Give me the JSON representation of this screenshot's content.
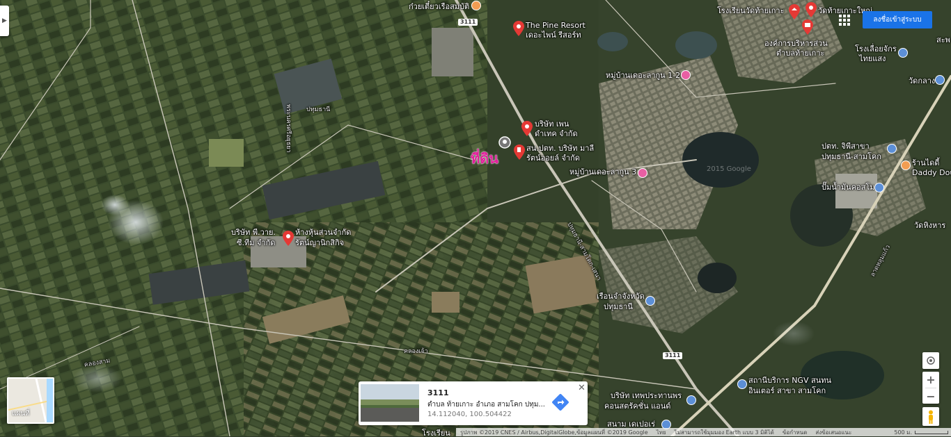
{
  "map": {
    "labels": [
      {
        "id": "pine-resort-en",
        "text": "The Pine Resort"
      },
      {
        "id": "pine-resort-th",
        "text": "เดอะไพน์ รีสอร์ท"
      },
      {
        "id": "noodle-shop",
        "text": "ก๋วยเตี๋ยวเรือสมบัติ"
      },
      {
        "id": "school",
        "text": "โรงเรียนวัดท้ายเกาะ"
      },
      {
        "id": "temple",
        "text": "วัดท้ายเกาะใหญ่"
      },
      {
        "id": "sao-1",
        "text": "องค์การบริหารส่วน"
      },
      {
        "id": "sao-2",
        "text": "ตำบลท้ายเกาะ"
      },
      {
        "id": "sawmill-1",
        "text": "โรงเลื่อยจักร"
      },
      {
        "id": "sawmill-2",
        "text": "ไทยแสง"
      },
      {
        "id": "wat-klang",
        "text": "วัดกลาง"
      },
      {
        "id": "sapha",
        "text": "สะพ"
      },
      {
        "id": "village-1-2",
        "text": "หมู่บ้านเดอะลากูน 1-2"
      },
      {
        "id": "village-3",
        "text": "หมู่บ้านเดอะลากูน 3"
      },
      {
        "id": "penn-1",
        "text": "บริษัท เพน"
      },
      {
        "id": "penn-2",
        "text": "ดำเทค จำกัด"
      },
      {
        "id": "ptt-1",
        "text": "สน.ปตท. บริษัท มาลี"
      },
      {
        "id": "ptt-2",
        "text": "รัตน์ออยล์ จำกัด"
      },
      {
        "id": "ayutthaya-1",
        "text": "พระนครศรีอยุธยา"
      },
      {
        "id": "ayutthaya-2",
        "text": "ปทุมธานี"
      },
      {
        "id": "pw-1",
        "text": "บริษัท พี.วาย."
      },
      {
        "id": "pw-2",
        "text": "ซี.ทีม จำกัด"
      },
      {
        "id": "hk-1",
        "text": "ห้างหุ้นส่วนจำกัด"
      },
      {
        "id": "hk-2",
        "text": "รัตน์ญานิกสิกิจ"
      },
      {
        "id": "ptt-jipi-1",
        "text": "ปตท. จิพีสาขา"
      },
      {
        "id": "ptt-jipi-2",
        "text": "ปทุมธานี-สามโคก"
      },
      {
        "id": "fuel-koslam",
        "text": "ปั๊มน้ำมันคอสโม"
      },
      {
        "id": "daddy-1",
        "text": "ร้านไดดี้"
      },
      {
        "id": "daddy-2",
        "text": "Daddy Dough"
      },
      {
        "id": "wat-hing",
        "text": "วัดหิงหาร"
      },
      {
        "id": "prison-1",
        "text": "เรือนจำจังหวัด"
      },
      {
        "id": "prison-2",
        "text": "ปทุมธานี"
      },
      {
        "id": "ngv-1",
        "text": "สถานีบริการ NGV สนทน"
      },
      {
        "id": "ngv-2",
        "text": "อินเตอร์ สาขา สามโคก"
      },
      {
        "id": "tep-1",
        "text": "บริษัท เทพประทานพร"
      },
      {
        "id": "tep-2",
        "text": "คอนสตรัคชั่น แอนด์"
      },
      {
        "id": "sanam",
        "text": "สนาม เดเปอเร่"
      },
      {
        "id": "rongrian",
        "text": "โรงเรียน"
      },
      {
        "id": "road-pathum",
        "text": "ปทุมธานี-สามโคก-เสนา"
      },
      {
        "id": "road-lat",
        "text": "ลาดหลุมแก้ว"
      },
      {
        "id": "canal-1",
        "text": "คลองเจ้า"
      },
      {
        "id": "canal-2",
        "text": "คลองสาม"
      }
    ],
    "road_numbers": [
      "3111",
      "3111"
    ],
    "highlight": "ที่ดิน",
    "watermark": "2015 Google"
  },
  "header": {
    "signin_label": "ลงชื่อเข้าสู่ระบบ",
    "apps_icon": "apps-grid-icon"
  },
  "card": {
    "title": "3111",
    "address": "ตำบล ท้ายเกาะ อำเภอ สามโคก ปทุม...",
    "coords": "14.112040, 100.504422",
    "close_icon": "close-icon",
    "directions_icon": "directions-icon"
  },
  "minimap": {
    "label": "แผนที่"
  },
  "controls": {
    "zoom_in": "+",
    "zoom_out": "−"
  },
  "footer": {
    "imagery": "รูปภาพ ©2019 CNES / Airbus,DigitalGlobe,ข้อมูลแผนที่ ©2019 Google",
    "country": "ไทย",
    "earth_note": "ไม่สามารถใช้มุมมอง Earth แบบ 3 มิติได้",
    "terms": "ข้อกำหนด",
    "feedback": "ส่งข้อเสนอแนะ",
    "scale": "500 ม."
  },
  "colors": {
    "accent": "#1a73e8",
    "pin": "#e53935",
    "highlight": "#e01f9a",
    "poi_pink": "#e95fa3",
    "poi_blue": "#5c8fd6"
  }
}
